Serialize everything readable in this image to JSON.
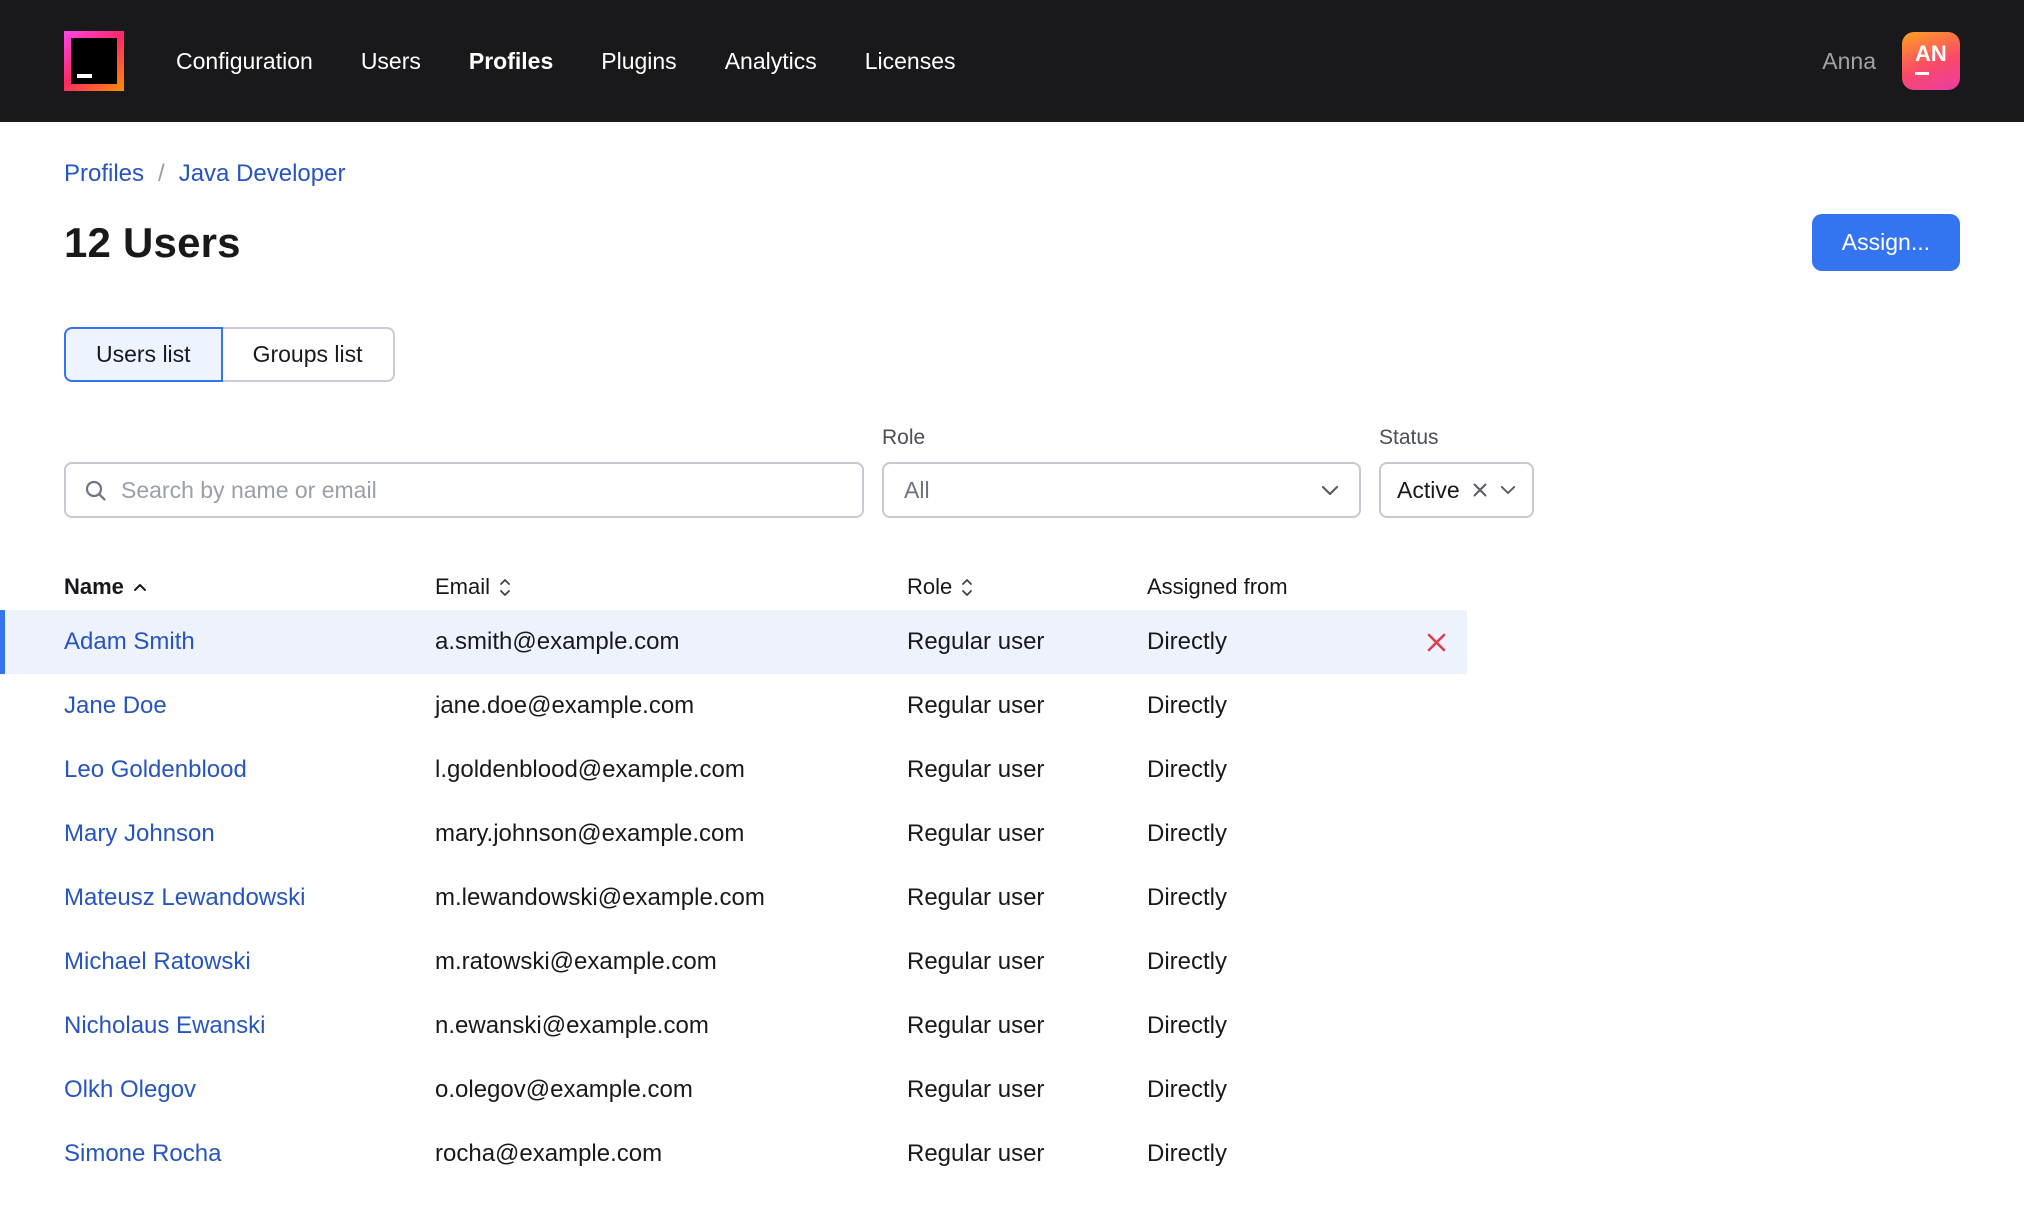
{
  "header": {
    "nav": [
      {
        "label": "Configuration",
        "active": false
      },
      {
        "label": "Users",
        "active": false
      },
      {
        "label": "Profiles",
        "active": true
      },
      {
        "label": "Plugins",
        "active": false
      },
      {
        "label": "Analytics",
        "active": false
      },
      {
        "label": "Licenses",
        "active": false
      }
    ],
    "user_name": "Anna",
    "avatar_initials": "AN"
  },
  "breadcrumb": {
    "items": [
      "Profiles",
      "Java Developer"
    ],
    "separator": "/"
  },
  "page": {
    "title": "12 Users",
    "assign_button_label": "Assign..."
  },
  "tabs": [
    {
      "label": "Users list",
      "active": true
    },
    {
      "label": "Groups list",
      "active": false
    }
  ],
  "filters": {
    "search_placeholder": "Search by name or email",
    "role_label": "Role",
    "role_value": "All",
    "status_label": "Status",
    "status_value": "Active"
  },
  "table": {
    "columns": [
      {
        "label": "Name",
        "sort": "asc"
      },
      {
        "label": "Email",
        "sort": "sortable"
      },
      {
        "label": "Role",
        "sort": "sortable"
      },
      {
        "label": "Assigned from",
        "sort": null
      }
    ],
    "rows": [
      {
        "name": "Adam Smith",
        "email": "a.smith@example.com",
        "role": "Regular user",
        "assigned_from": "Directly",
        "selected": true
      },
      {
        "name": "Jane Doe",
        "email": "jane.doe@example.com",
        "role": "Regular user",
        "assigned_from": "Directly",
        "selected": false
      },
      {
        "name": "Leo Goldenblood",
        "email": "l.goldenblood@example.com",
        "role": "Regular user",
        "assigned_from": "Directly",
        "selected": false
      },
      {
        "name": "Mary Johnson",
        "email": "mary.johnson@example.com",
        "role": "Regular user",
        "assigned_from": "Directly",
        "selected": false
      },
      {
        "name": "Mateusz Lewandowski",
        "email": "m.lewandowski@example.com",
        "role": "Regular user",
        "assigned_from": "Directly",
        "selected": false
      },
      {
        "name": "Michael Ratowski",
        "email": "m.ratowski@example.com",
        "role": "Regular user",
        "assigned_from": "Directly",
        "selected": false
      },
      {
        "name": "Nicholaus Ewanski",
        "email": "n.ewanski@example.com",
        "role": "Regular user",
        "assigned_from": "Directly",
        "selected": false
      },
      {
        "name": "Olkh Olegov",
        "email": "o.olegov@example.com",
        "role": "Regular user",
        "assigned_from": "Directly",
        "selected": false
      },
      {
        "name": "Simone Rocha",
        "email": "rocha@example.com",
        "role": "Regular user",
        "assigned_from": "Directly",
        "selected": false
      }
    ]
  },
  "icons": {
    "logo": "jetbrains-logo",
    "search": "magnifier",
    "role_dropdown": "chevron-down",
    "status_clear": "x-clear",
    "status_dropdown": "chevron-down",
    "name_sort": "caret-up",
    "sortable": "caret-up-down",
    "row_delete": "red-x"
  },
  "colors": {
    "header_bg": "#19191c",
    "accent_blue": "#3574f0",
    "link_blue": "#2755bf",
    "selected_row_bg": "#edf2fd",
    "selected_tab_bg": "#edf3ff",
    "delete_red": "#db3e4d",
    "muted_text": "#6e737d"
  }
}
